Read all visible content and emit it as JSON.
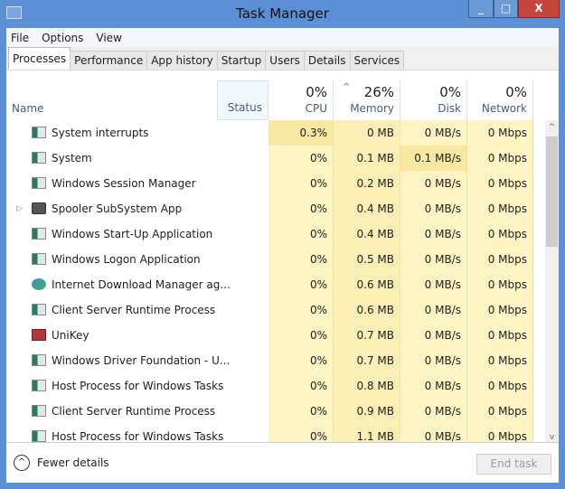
{
  "window": {
    "title": "Task Manager"
  },
  "menu": [
    "File",
    "Options",
    "View"
  ],
  "tabs": [
    "Processes",
    "Performance",
    "App history",
    "Startup",
    "Users",
    "Details",
    "Services"
  ],
  "header": {
    "name": "Name",
    "status": "Status",
    "cpu_pct": "0%",
    "cpu": "CPU",
    "mem_pct": "26%",
    "mem": "Memory",
    "disk_pct": "0%",
    "disk": "Disk",
    "net_pct": "0%",
    "net": "Network"
  },
  "rows": [
    {
      "name": "System interrupts",
      "cpu": "0.3%",
      "mem": "0 MB",
      "disk": "0 MB/s",
      "net": "0 Mbps",
      "icon": "window-icon"
    },
    {
      "name": "System",
      "cpu": "0%",
      "mem": "0.1 MB",
      "disk": "0.1 MB/s",
      "net": "0 Mbps",
      "icon": "window-icon"
    },
    {
      "name": "Windows Session Manager",
      "cpu": "0%",
      "mem": "0.2 MB",
      "disk": "0 MB/s",
      "net": "0 Mbps",
      "icon": "window-icon"
    },
    {
      "name": "Spooler SubSystem App",
      "cpu": "0%",
      "mem": "0.4 MB",
      "disk": "0 MB/s",
      "net": "0 Mbps",
      "icon": "printer-icon",
      "expandable": true
    },
    {
      "name": "Windows Start-Up Application",
      "cpu": "0%",
      "mem": "0.4 MB",
      "disk": "0 MB/s",
      "net": "0 Mbps",
      "icon": "window-icon"
    },
    {
      "name": "Windows Logon Application",
      "cpu": "0%",
      "mem": "0.5 MB",
      "disk": "0 MB/s",
      "net": "0 Mbps",
      "icon": "window-icon"
    },
    {
      "name": "Internet Download Manager ag...",
      "cpu": "0%",
      "mem": "0.6 MB",
      "disk": "0 MB/s",
      "net": "0 Mbps",
      "icon": "idm-icon"
    },
    {
      "name": "Client Server Runtime Process",
      "cpu": "0%",
      "mem": "0.6 MB",
      "disk": "0 MB/s",
      "net": "0 Mbps",
      "icon": "window-icon"
    },
    {
      "name": "UniKey",
      "cpu": "0%",
      "mem": "0.7 MB",
      "disk": "0 MB/s",
      "net": "0 Mbps",
      "icon": "unikey-icon"
    },
    {
      "name": "Windows Driver Foundation - U...",
      "cpu": "0%",
      "mem": "0.7 MB",
      "disk": "0 MB/s",
      "net": "0 Mbps",
      "icon": "window-icon"
    },
    {
      "name": "Host Process for Windows Tasks",
      "cpu": "0%",
      "mem": "0.8 MB",
      "disk": "0 MB/s",
      "net": "0 Mbps",
      "icon": "window-icon"
    },
    {
      "name": "Client Server Runtime Process",
      "cpu": "0%",
      "mem": "0.9 MB",
      "disk": "0 MB/s",
      "net": "0 Mbps",
      "icon": "window-icon"
    },
    {
      "name": "Host Process for Windows Tasks",
      "cpu": "0%",
      "mem": "1.1 MB",
      "disk": "0 MB/s",
      "net": "0 Mbps",
      "icon": "window-icon"
    }
  ],
  "footer": {
    "fewer": "Fewer details",
    "end_task": "End task"
  }
}
